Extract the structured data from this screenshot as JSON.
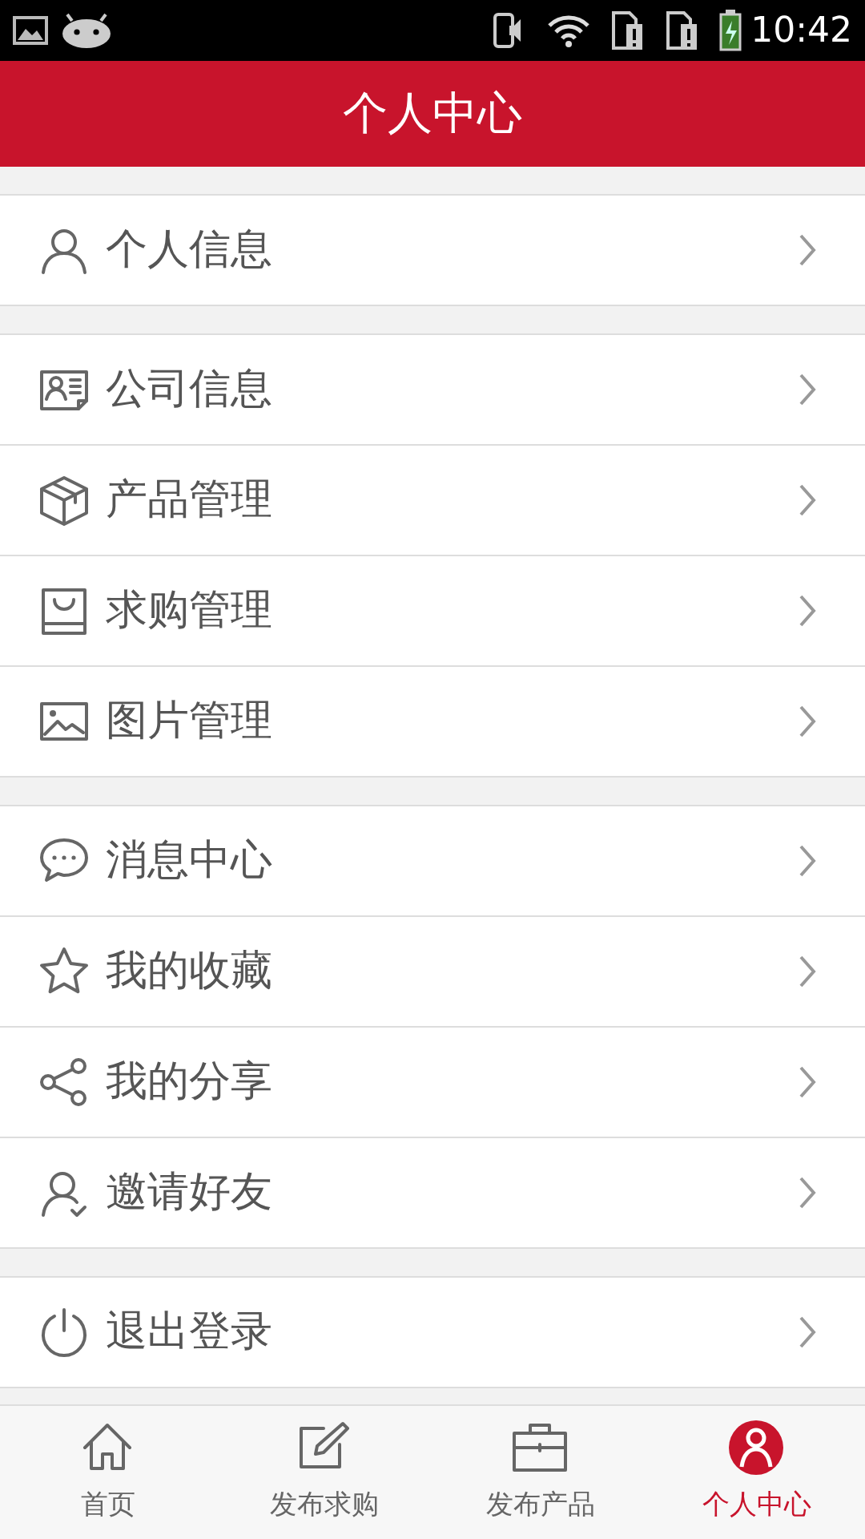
{
  "status_bar": {
    "time": "10:42"
  },
  "header": {
    "title": "个人中心"
  },
  "menu_groups": [
    {
      "items": [
        {
          "label": "个人信息"
        }
      ]
    },
    {
      "items": [
        {
          "label": "公司信息"
        },
        {
          "label": "产品管理"
        },
        {
          "label": "求购管理"
        },
        {
          "label": "图片管理"
        }
      ]
    },
    {
      "items": [
        {
          "label": "消息中心"
        },
        {
          "label": "我的收藏"
        },
        {
          "label": "我的分享"
        },
        {
          "label": "邀请好友"
        }
      ]
    },
    {
      "items": [
        {
          "label": "退出登录"
        }
      ]
    }
  ],
  "bottom_nav": [
    {
      "label": "首页",
      "selected": false
    },
    {
      "label": "发布求购",
      "selected": false
    },
    {
      "label": "发布产品",
      "selected": false
    },
    {
      "label": "个人中心",
      "selected": true
    }
  ]
}
